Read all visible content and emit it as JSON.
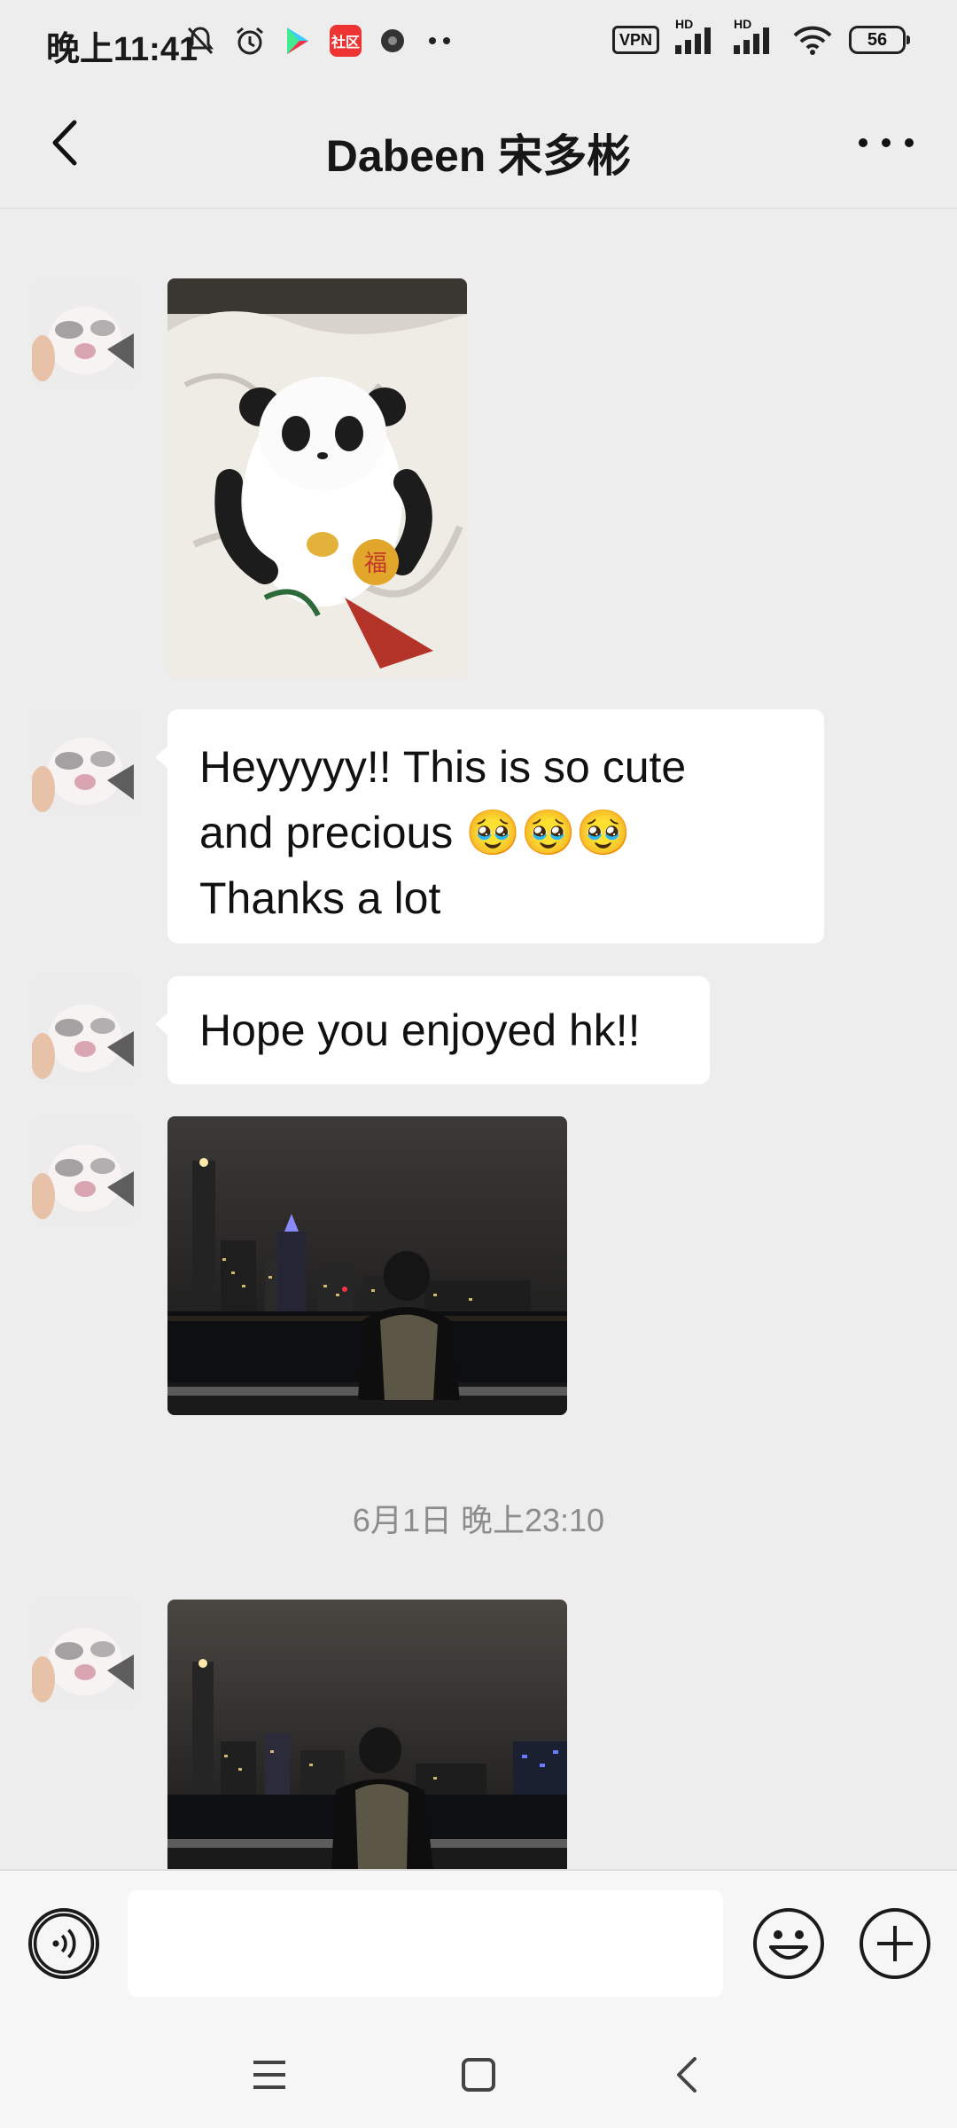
{
  "status_bar": {
    "time": "晚上11:41",
    "app_badge": "社区",
    "vpn": "VPN",
    "signal_1": "HD",
    "signal_2": "HD",
    "battery": "56"
  },
  "header": {
    "title": "Dabeen 宋多彬"
  },
  "messages": [
    {
      "type": "image",
      "content": "panda figurine photo"
    },
    {
      "type": "text",
      "lines": [
        "Heyyyyy!! This is so cute",
        "and precious 🥹🥹🥹",
        "Thanks a lot"
      ]
    },
    {
      "type": "text",
      "lines": [
        "Hope you enjoyed hk!!"
      ]
    },
    {
      "type": "image",
      "content": "night harbour photo"
    },
    {
      "type": "timestamp",
      "text": "6月1日 晚上23:10"
    },
    {
      "type": "image",
      "content": "night harbour photo 2"
    }
  ],
  "icons": {
    "back": "back-arrow-icon",
    "more": "more-dots-icon",
    "voice": "voice-icon",
    "emoji": "emoji-icon",
    "plus": "plus-icon",
    "nav_menu": "menu-icon",
    "nav_home": "home-icon",
    "nav_back": "back-nav-icon"
  },
  "colors": {
    "chat_bg": "#ededed",
    "bubble_bg": "#ffffff"
  }
}
